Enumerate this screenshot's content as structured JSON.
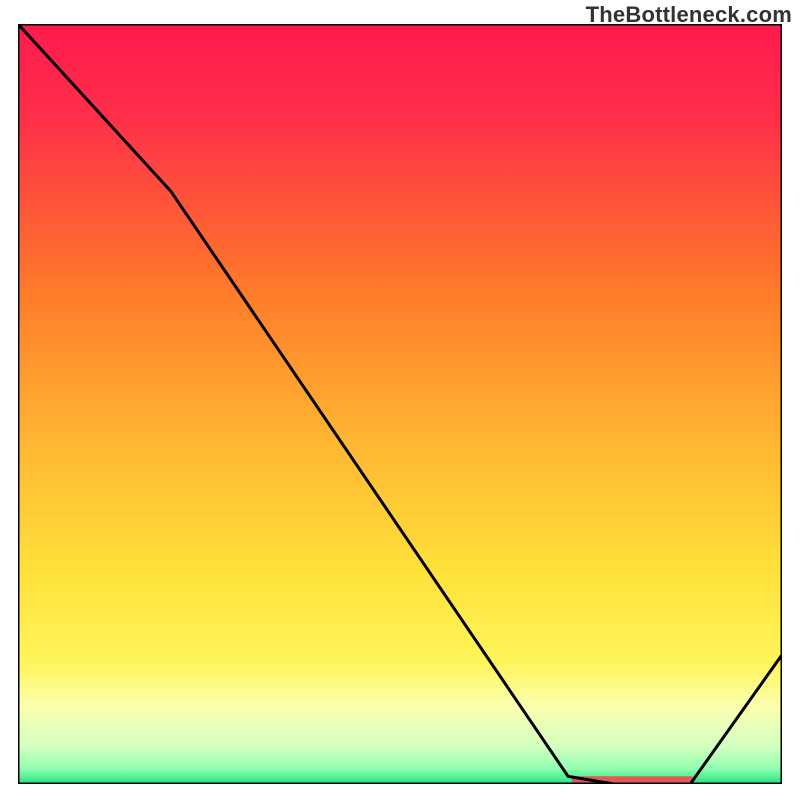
{
  "watermark": "TheBottleneck.com",
  "chart_data": {
    "type": "line",
    "title": "",
    "xlabel": "",
    "ylabel": "",
    "xlim": [
      0,
      100
    ],
    "ylim": [
      0,
      100
    ],
    "series": [
      {
        "name": "curve",
        "x": [
          0,
          20,
          72,
          78,
          88,
          100
        ],
        "values": [
          100,
          78,
          1,
          0,
          0,
          17
        ]
      }
    ],
    "optimal_band": {
      "x_start": 73,
      "x_end": 88,
      "y": 0.5
    },
    "gradient_stops": [
      {
        "offset": 0,
        "color": "#ff1a4d"
      },
      {
        "offset": 12,
        "color": "#ff2e4a"
      },
      {
        "offset": 35,
        "color": "#ff7a2a"
      },
      {
        "offset": 55,
        "color": "#ffb632"
      },
      {
        "offset": 72,
        "color": "#ffe13a"
      },
      {
        "offset": 84,
        "color": "#fff55a"
      },
      {
        "offset": 90,
        "color": "#faffb0"
      },
      {
        "offset": 95,
        "color": "#d4ffc0"
      },
      {
        "offset": 98,
        "color": "#8fffb0"
      },
      {
        "offset": 100,
        "color": "#22e37a"
      }
    ]
  }
}
